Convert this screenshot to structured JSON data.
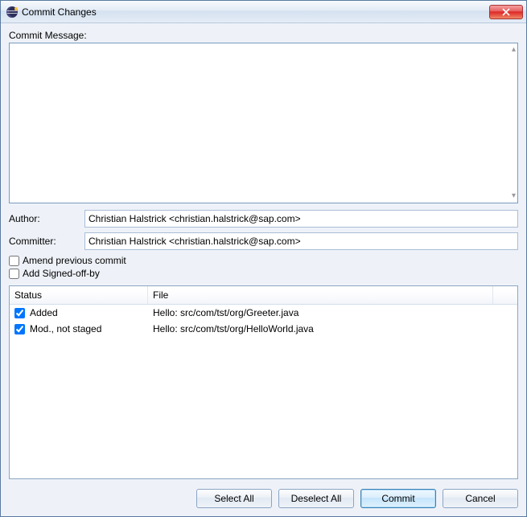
{
  "window": {
    "title": "Commit Changes"
  },
  "commitMessage": {
    "label": "Commit Message:",
    "value": ""
  },
  "author": {
    "label": "Author:",
    "value": "Christian Halstrick <christian.halstrick@sap.com>"
  },
  "committer": {
    "label": "Committer:",
    "value": "Christian Halstrick <christian.halstrick@sap.com>"
  },
  "options": {
    "amend": {
      "label": "Amend previous commit",
      "checked": false
    },
    "signoff": {
      "label": "Add Signed-off-by",
      "checked": false
    }
  },
  "table": {
    "headers": {
      "status": "Status",
      "file": "File"
    },
    "rows": [
      {
        "checked": true,
        "status": "Added",
        "file": "Hello: src/com/tst/org/Greeter.java"
      },
      {
        "checked": true,
        "status": "Mod., not staged",
        "file": "Hello: src/com/tst/org/HelloWorld.java"
      }
    ]
  },
  "buttons": {
    "selectAll": "Select All",
    "deselectAll": "Deselect All",
    "commit": "Commit",
    "cancel": "Cancel"
  }
}
